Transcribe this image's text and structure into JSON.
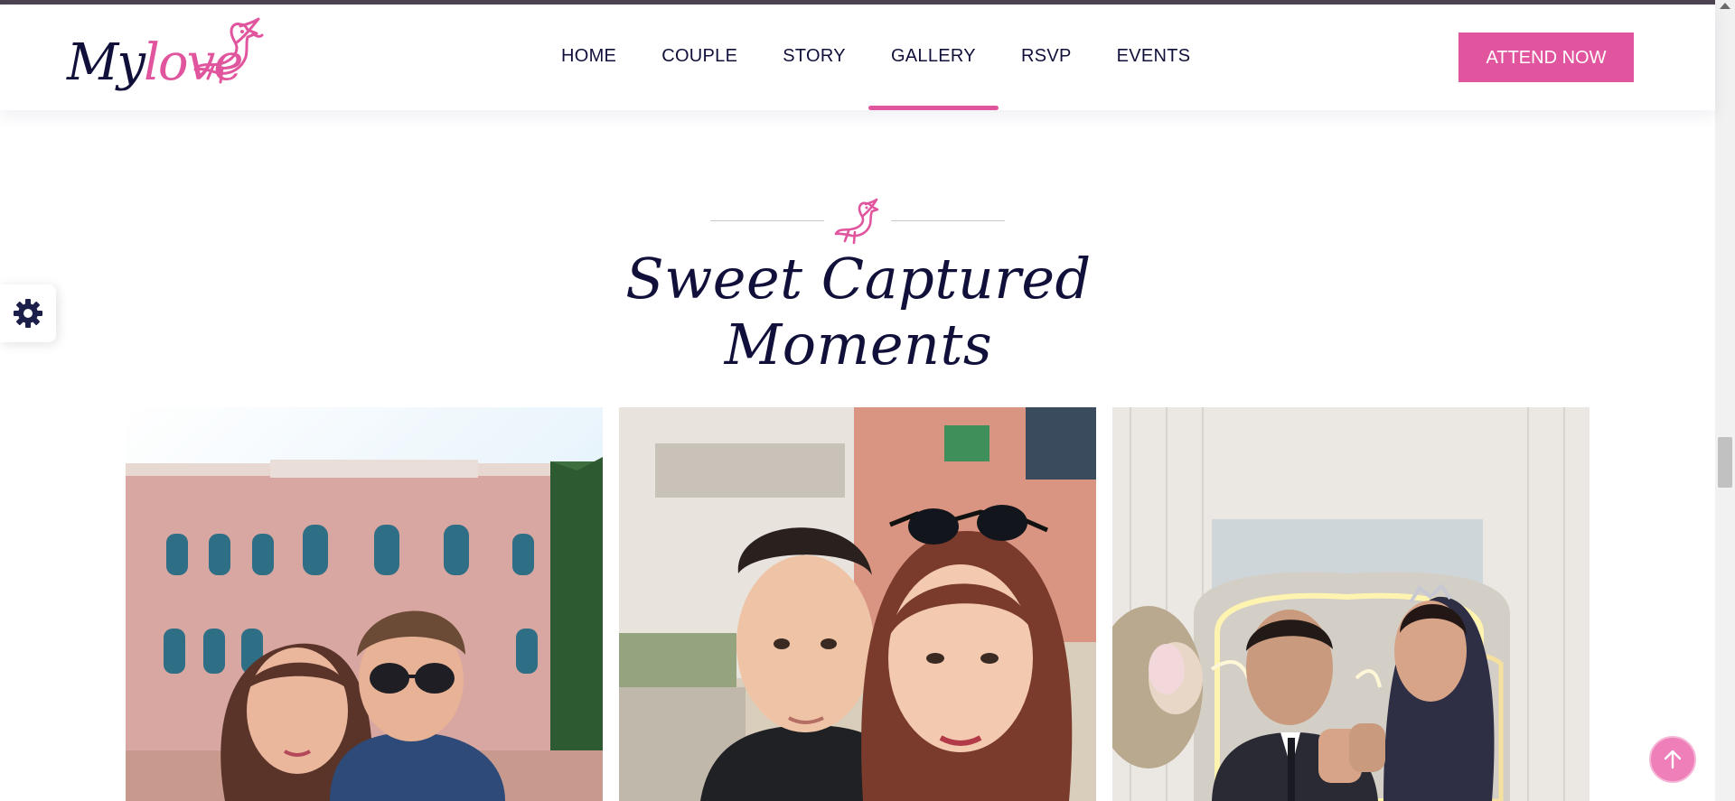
{
  "logo": {
    "part1": "My",
    "part2": "love"
  },
  "nav": {
    "items": [
      {
        "label": "HOME"
      },
      {
        "label": "COUPLE"
      },
      {
        "label": "STORY"
      },
      {
        "label": "GALLERY",
        "active": true
      },
      {
        "label": "RSVP"
      },
      {
        "label": "EVENTS"
      }
    ]
  },
  "header": {
    "cta_label": "ATTEND NOW"
  },
  "gallery": {
    "title": "Sweet Captured Moments",
    "photos": [
      {
        "name": "couple-selfie-historic-building"
      },
      {
        "name": "couple-selfie-street"
      },
      {
        "name": "couple-engagement-neon"
      }
    ]
  },
  "colors": {
    "accent": "#e0559d",
    "navy": "#10103a",
    "gear": "#1c1f4a"
  },
  "icons": {
    "settings": "gear-icon",
    "back_to_top": "arrow-up-icon",
    "dove": "dove-icon"
  }
}
